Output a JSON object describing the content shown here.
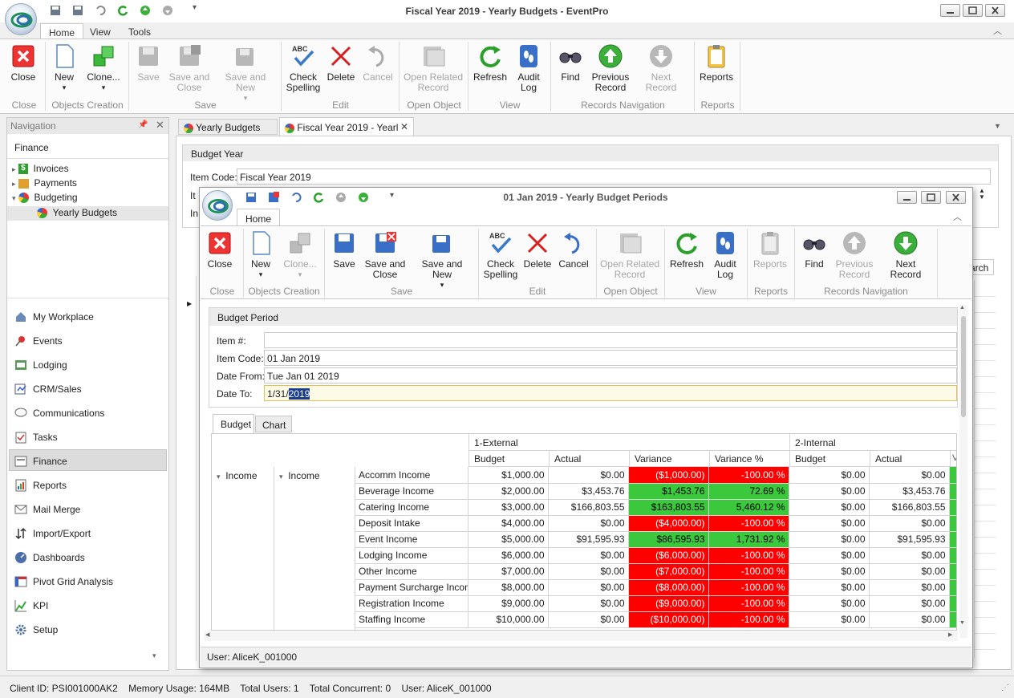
{
  "app": {
    "title": "Fiscal Year 2019 - Yearly Budgets - EventPro",
    "menu_tabs": [
      "Home",
      "View",
      "Tools"
    ]
  },
  "main_ribbon": {
    "buttons": {
      "close": "Close",
      "new": "New",
      "clone": "Clone...",
      "save": "Save",
      "save_close": "Save and Close",
      "save_new": "Save and New",
      "check_spelling": "Check Spelling",
      "delete": "Delete",
      "cancel": "Cancel",
      "open_related": "Open Related Record",
      "refresh": "Refresh",
      "audit_log": "Audit Log",
      "find": "Find",
      "previous": "Previous Record",
      "next": "Next Record",
      "reports": "Reports"
    },
    "groups": [
      "Close",
      "Objects Creation",
      "Save",
      "Edit",
      "Open Object",
      "View",
      "Records Navigation",
      "Reports"
    ]
  },
  "navigation": {
    "header": "Navigation",
    "section": "Finance",
    "tree": [
      "Invoices",
      "Payments",
      "Budgeting",
      "Yearly Budgets"
    ],
    "items": [
      "My Workplace",
      "Events",
      "Lodging",
      "CRM/Sales",
      "Communications",
      "Tasks",
      "Finance",
      "Reports",
      "Mail Merge",
      "Import/Export",
      "Dashboards",
      "Pivot Grid Analysis",
      "KPI",
      "Setup"
    ]
  },
  "doc_tabs": [
    "Yearly Budgets",
    "Fiscal Year 2019 - Yearl"
  ],
  "budget_year": {
    "group_title": "Budget Year",
    "item_code_label": "Item Code:",
    "item_code_value": "Fiscal Year 2019",
    "it_label": "It",
    "in_label": "In",
    "search_partial": "arch"
  },
  "dialog": {
    "title": "01 Jan 2019 - Yearly Budget Periods",
    "tab": "Home",
    "buttons": {
      "close": "Close",
      "new": "New",
      "clone": "Clone...",
      "save": "Save",
      "save_close": "Save and Close",
      "save_new": "Save and New",
      "check_spelling": "Check Spelling",
      "delete": "Delete",
      "cancel": "Cancel",
      "open_related": "Open Related Record",
      "refresh": "Refresh",
      "audit_log": "Audit Log",
      "reports": "Reports",
      "find": "Find",
      "previous": "Previous Record",
      "next": "Next Record"
    },
    "groups": [
      "Close",
      "Objects Creation",
      "Save",
      "Edit",
      "Open Object",
      "View",
      "Reports",
      "Records Navigation"
    ],
    "period": {
      "group_title": "Budget Period",
      "item_no_label": "Item #:",
      "item_no_value": "",
      "item_code_label": "Item Code:",
      "item_code_value": "01 Jan 2019",
      "date_from_label": "Date From:",
      "date_from_value": "Tue Jan 01 2019",
      "date_to_label": "Date To:",
      "date_to_prefix": "1/31/",
      "date_to_selected": "2019"
    },
    "subtabs": [
      "Budget",
      "Chart"
    ],
    "grid": {
      "group1": "1-External",
      "group2": "2-Internal",
      "columns": [
        "Budget",
        "Actual",
        "Variance",
        "Variance %",
        "Budget",
        "Actual"
      ],
      "row_level1": "Income",
      "row_level2": "Income",
      "rows": [
        {
          "name": "Accomm Income",
          "budget": "$1,000.00",
          "actual": "$0.00",
          "variance": "($1,000.00)",
          "pct": "-100.00 %",
          "status": "red",
          "b2": "$0.00",
          "a2": "$0.00"
        },
        {
          "name": "Beverage Income",
          "budget": "$2,000.00",
          "actual": "$3,453.76",
          "variance": "$1,453.76",
          "pct": "72.69 %",
          "status": "green",
          "b2": "$0.00",
          "a2": "$3,453.76"
        },
        {
          "name": "Catering Income",
          "budget": "$3,000.00",
          "actual": "$166,803.55",
          "variance": "$163,803.55",
          "pct": "5,460.12 %",
          "status": "green",
          "b2": "$0.00",
          "a2": "$166,803.55"
        },
        {
          "name": "Deposit Intake",
          "budget": "$4,000.00",
          "actual": "$0.00",
          "variance": "($4,000.00)",
          "pct": "-100.00 %",
          "status": "red",
          "b2": "$0.00",
          "a2": "$0.00"
        },
        {
          "name": "Event Income",
          "budget": "$5,000.00",
          "actual": "$91,595.93",
          "variance": "$86,595.93",
          "pct": "1,731.92 %",
          "status": "green",
          "b2": "$0.00",
          "a2": "$91,595.93"
        },
        {
          "name": "Lodging Income",
          "budget": "$6,000.00",
          "actual": "$0.00",
          "variance": "($6,000.00)",
          "pct": "-100.00 %",
          "status": "red",
          "b2": "$0.00",
          "a2": "$0.00"
        },
        {
          "name": "Other Income",
          "budget": "$7,000.00",
          "actual": "$0.00",
          "variance": "($7,000.00)",
          "pct": "-100.00 %",
          "status": "red",
          "b2": "$0.00",
          "a2": "$0.00"
        },
        {
          "name": "Payment Surcharge Income",
          "budget": "$8,000.00",
          "actual": "$0.00",
          "variance": "($8,000.00)",
          "pct": "-100.00 %",
          "status": "red",
          "b2": "$0.00",
          "a2": "$0.00"
        },
        {
          "name": "Registration Income",
          "budget": "$9,000.00",
          "actual": "$0.00",
          "variance": "($9,000.00)",
          "pct": "-100.00 %",
          "status": "red",
          "b2": "$0.00",
          "a2": "$0.00"
        },
        {
          "name": "Staffing Income",
          "budget": "$10,000.00",
          "actual": "$0.00",
          "variance": "($10,000.00)",
          "pct": "-100.00 %",
          "status": "red",
          "b2": "$0.00",
          "a2": "$0.00"
        }
      ]
    },
    "footer_user": "User: AliceK_001000"
  },
  "status_bar": "Client ID: PSI001000AK2    Memory Usage: 164MB    Total Users: 1    Total Concurrent: 0    User: AliceK_001000",
  "colors": {
    "negative": "#ff0000",
    "positive": "#3cc83c",
    "accent": "#2b6cb0"
  }
}
